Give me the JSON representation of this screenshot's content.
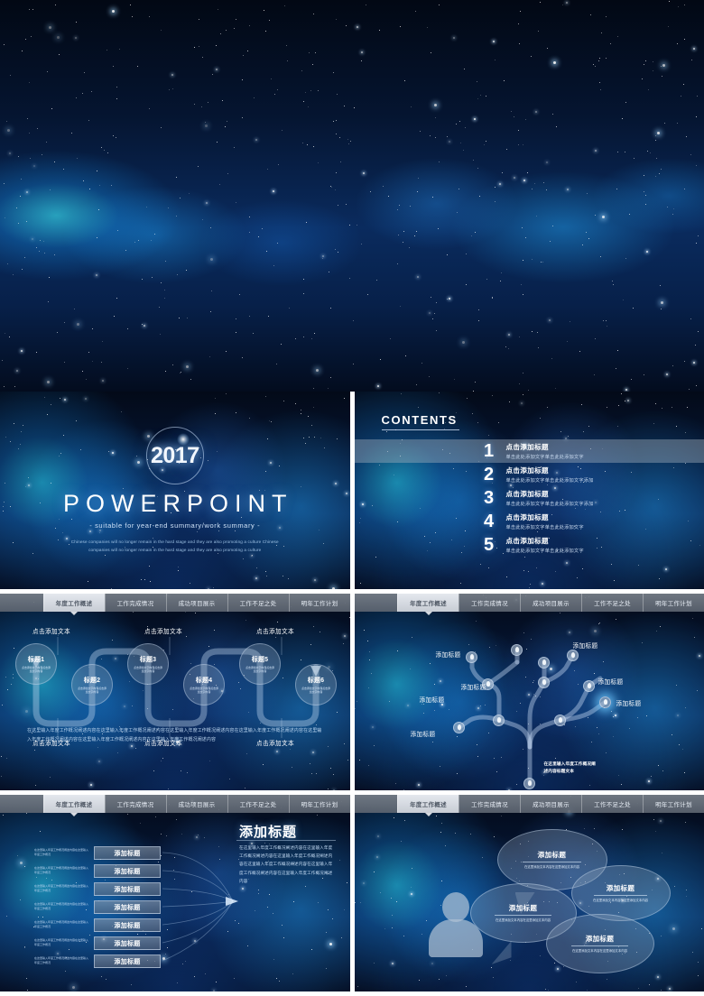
{
  "deck": {
    "hero": {
      "alt": "starry-galaxy-background"
    },
    "nav_tabs": [
      "年度工作概述",
      "工作完成情况",
      "成功项目展示",
      "工作不足之处",
      "明年工作计划"
    ],
    "active_tab": "年度工作概述"
  },
  "title_slide": {
    "year": "2017",
    "title": "POWERPOINT",
    "subtitle": "- suitable for year-end summary/work summary -",
    "paragraph": "Chinese companies will no longer remain in the hard stage and they are also promoting a culture Chinese companies will no longer remain in the hard stage and they are also promoting a culture"
  },
  "contents_slide": {
    "heading": "CONTENTS",
    "items": [
      {
        "num": "1",
        "title": "点击添加标题",
        "sub": "单击此处添加文字单击此处添加文字",
        "highlighted": true
      },
      {
        "num": "2",
        "title": "点击添加标题",
        "sub": "单击此处添加文字单击此处添加文字添加",
        "highlighted": false
      },
      {
        "num": "3",
        "title": "点击添加标题",
        "sub": "单击此处添加文字单击此处添加文字添加",
        "highlighted": false
      },
      {
        "num": "4",
        "title": "点击添加标题",
        "sub": "单击此处添加文字单击此处添加文字",
        "highlighted": false
      },
      {
        "num": "5",
        "title": "点击添加标题",
        "sub": "单击此处添加文字单击此处添加文字",
        "highlighted": false
      }
    ]
  },
  "process_slide": {
    "nodes": [
      {
        "title": "标题1",
        "body": "点击添加文字内容点击添加文字内容"
      },
      {
        "title": "标题2",
        "body": "点击添加文字内容点击添加文字内容"
      },
      {
        "title": "标题3",
        "body": "点击添加文字内容点击添加文字内容"
      },
      {
        "title": "标题4",
        "body": "点击添加文字内容点击添加文字内容"
      },
      {
        "title": "标题5",
        "body": "点击添加文字内容点击添加文字内容"
      },
      {
        "title": "标题6",
        "body": "点击添加文字内容点击添加文字内容"
      }
    ],
    "top_labels": [
      "点击添加文本",
      "点击添加文本",
      "点击添加文本"
    ],
    "bottom_labels": [
      "点击添加文本",
      "点击添加文本",
      "点击添加文本"
    ],
    "paragraph": "在这里输入年度工作概况阐述内容在这里输入年度工作概况阐述内容在这里输入年度工作概况阐述内容在这里输入年度工作概况阐述内容在这里输入年度工作概况阐述内容在这里输入年度工作概况阐述内容在这里输入年度工作概况阐述内容"
  },
  "tree_slide": {
    "labels": [
      "添加标题",
      "添加标题",
      "添加标题",
      "添加标题",
      "添加标题",
      "添加标题",
      "添加标题"
    ],
    "caption": "在这里输入年度工作概况阐述内容标题文本"
  },
  "bars_slide": {
    "bars": [
      {
        "label": "添加标题",
        "note": "在这里输入年度工作概况阐述内容在这里输入年度工作概况"
      },
      {
        "label": "添加标题",
        "note": "在这里输入年度工作概况阐述内容在这里输入年度工作概况"
      },
      {
        "label": "添加标题",
        "note": "在这里输入年度工作概况阐述内容在这里输入年度工作概况"
      },
      {
        "label": "添加标题",
        "note": "在这里输入年度工作概况阐述内容在这里输入年度工作概况"
      },
      {
        "label": "添加标题",
        "note": "在这里输入年度工作概况阐述内容在这里输入年度工作概况"
      },
      {
        "label": "添加标题",
        "note": "在这里输入年度工作概况阐述内容在这里输入年度工作概况"
      },
      {
        "label": "添加标题",
        "note": "在这里输入年度工作概况阐述内容在这里输入年度工作概况"
      }
    ],
    "right_title": "添加标题",
    "right_body": "在这里输入年度工作概况阐述内容在这里输入年度工作概况阐述内容在这里输入年度工作概况阐述内容在这里输入年度工作概况阐述内容在这里输入年度工作概况阐述内容在这里输入年度工作概况阐述内容"
  },
  "bubbles_slide": {
    "bubbles": [
      {
        "title": "添加标题",
        "body": "在这里添加文本内容在这里添加文本内容"
      },
      {
        "title": "添加标题",
        "body": "在这里添加文本内容在这里添加文本内容"
      },
      {
        "title": "添加标题",
        "body": "在这里添加文本内容在这里添加文本内容"
      },
      {
        "title": "添加标题",
        "body": "在这里添加文本内容在这里添加文本内容"
      }
    ]
  },
  "colors": {
    "deep_space": "#040d1f",
    "nebula_cyan": "#2ddcff",
    "nebula_blue": "#1a8ce6",
    "tab_bar": "#6a7280",
    "tab_active": "#d9dee5",
    "text_primary": "#ffffff",
    "text_secondary": "#c3daf2"
  }
}
